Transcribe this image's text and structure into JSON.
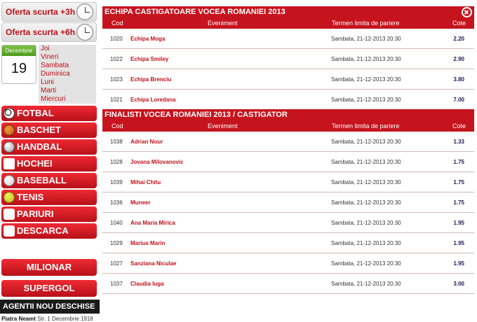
{
  "sidebar": {
    "quick": [
      {
        "label": "Oferta scurta +3h"
      },
      {
        "label": "Oferta scurta +6h"
      }
    ],
    "calendar": {
      "month": "Decembrie",
      "day": "19"
    },
    "days": [
      "Joi",
      "Vineri",
      "Sambata",
      "Duminica",
      "Luni",
      "Marti",
      "Miercuri"
    ],
    "sports": [
      {
        "label": "FOTBAL",
        "icon": "football-icon"
      },
      {
        "label": "BASCHET",
        "icon": "basketball-icon"
      },
      {
        "label": "HANDBAL",
        "icon": "handball-icon"
      },
      {
        "label": "HOCHEI",
        "icon": "hockey-icon"
      },
      {
        "label": "BASEBALL",
        "icon": "baseball-icon"
      },
      {
        "label": "TENIS",
        "icon": "tennis-icon"
      },
      {
        "label": "PARIURI SPECIALE",
        "icon": "special-bets-icon"
      },
      {
        "label": "DESCARCA OFERTA",
        "icon": "download-icon"
      }
    ],
    "milionar": "MILIONAR",
    "supergol": "SUPERGOL",
    "agentii_title": "AGENTII NOU DESCHISE",
    "agentii_city": "Piatra Neamt",
    "agentii_street": "Str. 1 Decembrie 1918"
  },
  "columns": {
    "cod": "Cod",
    "eveniment": "Eveniment",
    "termen": "Termen limita de pariere",
    "cote": "Cote"
  },
  "sections": [
    {
      "title": "ECHIPA CASTIGATOARE VOCEA ROMANIEI 2013",
      "rows": [
        {
          "cod": "1020",
          "eveniment": "Echipa Moga",
          "termen": "Sambata, 21-12-2013 20:30",
          "cote": "2.20"
        },
        {
          "cod": "1022",
          "eveniment": "Echipa Smiley",
          "termen": "Sambata, 21-12-2013 20:30",
          "cote": "2.90"
        },
        {
          "cod": "1023",
          "eveniment": "Echipa Brenciu",
          "termen": "Sambata, 21-12-2013 20:30",
          "cote": "3.80"
        },
        {
          "cod": "1021",
          "eveniment": "Echipa Loredana",
          "termen": "Sambata, 21-12-2013 20:30",
          "cote": "7.00"
        }
      ]
    },
    {
      "title": "FINALISTI VOCEA ROMANIEI 2013 / CASTIGATOR",
      "rows": [
        {
          "cod": "1038",
          "eveniment": "Adrian Nour",
          "termen": "Sambata, 21-12-2013 20:30",
          "cote": "1.33"
        },
        {
          "cod": "1028",
          "eveniment": "Jovana Milovanovic",
          "termen": "Sambata, 21-12-2013 20:30",
          "cote": "1.75"
        },
        {
          "cod": "1039",
          "eveniment": "Mihai Chitu",
          "termen": "Sambata, 21-12-2013 20:30",
          "cote": "1.75"
        },
        {
          "cod": "1036",
          "eveniment": "Muneer",
          "termen": "Sambata, 21-12-2013 20:30",
          "cote": "1.75"
        },
        {
          "cod": "1040",
          "eveniment": "Ana Maria Mirica",
          "termen": "Sambata, 21-12-2013 20:30",
          "cote": "1.95"
        },
        {
          "cod": "1029",
          "eveniment": "Marius Marin",
          "termen": "Sambata, 21-12-2013 20:30",
          "cote": "1.95"
        },
        {
          "cod": "1027",
          "eveniment": "Sanziana Niculae",
          "termen": "Sambata, 21-12-2013 20:30",
          "cote": "1.95"
        },
        {
          "cod": "1037",
          "eveniment": "Claudia Iuga",
          "termen": "Sambata, 21-12-2013 20:30",
          "cote": "3.00"
        }
      ]
    }
  ],
  "colors": {
    "brand_red": "#c6141e",
    "link_red": "#c0101a",
    "odds_blue": "#1a1a55"
  }
}
